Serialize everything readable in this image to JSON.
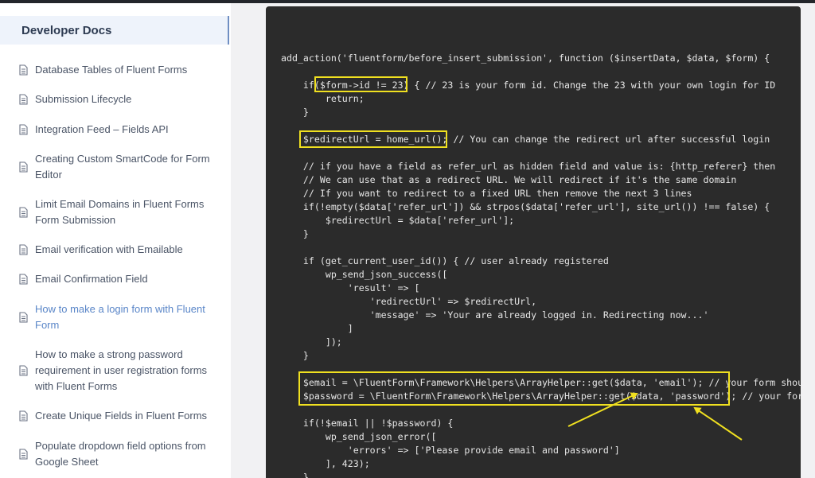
{
  "sidebar": {
    "header": "Developer Docs",
    "items": [
      {
        "label": "Database Tables of Fluent Forms",
        "active": false
      },
      {
        "label": "Submission Lifecycle",
        "active": false
      },
      {
        "label": "Integration Feed – Fields API",
        "active": false
      },
      {
        "label": "Creating Custom SmartCode for Form Editor",
        "active": false
      },
      {
        "label": "Limit Email Domains in Fluent Forms Form Submission",
        "active": false
      },
      {
        "label": "Email verification with Emailable",
        "active": false
      },
      {
        "label": "Email Confirmation Field",
        "active": false
      },
      {
        "label": "How to make a login form with Fluent Form",
        "active": true
      },
      {
        "label": "How to make a strong password requirement in user registration forms with Fluent Forms",
        "active": false
      },
      {
        "label": "Create Unique Fields in Fluent Forms",
        "active": false
      },
      {
        "label": "Populate dropdown field options from Google Sheet",
        "active": false
      }
    ]
  },
  "code": {
    "l1": "add_action('fluentform/before_insert_submission', function ($insertData, $data, $form) {",
    "l2": "    if($form->id != 23) { // 23 is your form id. Change the 23 with your own login for ID",
    "l3": "        return;",
    "l4": "    }",
    "l5": "    $redirectUrl = home_url(); // You can change the redirect url after successful login",
    "l6": "    // if you have a field as refer_url as hidden field and value is: {http_referer} then",
    "l7": "    // We can use that as a redirect URL. We will redirect if it's the same domain",
    "l8": "    // If you want to redirect to a fixed URL then remove the next 3 lines",
    "l9": "    if(!empty($data['refer_url']) && strpos($data['refer_url'], site_url()) !== false) {",
    "l10": "        $redirectUrl = $data['refer_url'];",
    "l11": "    }",
    "l12": "    if (get_current_user_id()) { // user already registered",
    "l13": "        wp_send_json_success([",
    "l14": "            'result' => [",
    "l15": "                'redirectUrl' => $redirectUrl,",
    "l16": "                'message' => 'Your are already logged in. Redirecting now...'",
    "l17": "            ]",
    "l18": "        ]);",
    "l19": "    }",
    "l20": "    $email = \\FluentForm\\Framework\\Helpers\\ArrayHelper::get($data, 'email'); // your form should",
    "l21": "    $password = \\FluentForm\\Framework\\Helpers\\ArrayHelper::get($data, 'password'); // your form",
    "l22": "    if(!$email || !$password) {",
    "l23": "        wp_send_json_error([",
    "l24": "            'errors' => ['Please provide email and password']",
    "l25": "        ], 423);",
    "l26": "    }"
  },
  "colors": {
    "highlight": "#f0e020",
    "code_bg": "#2b2b2b",
    "active_link": "#5a86c8"
  }
}
